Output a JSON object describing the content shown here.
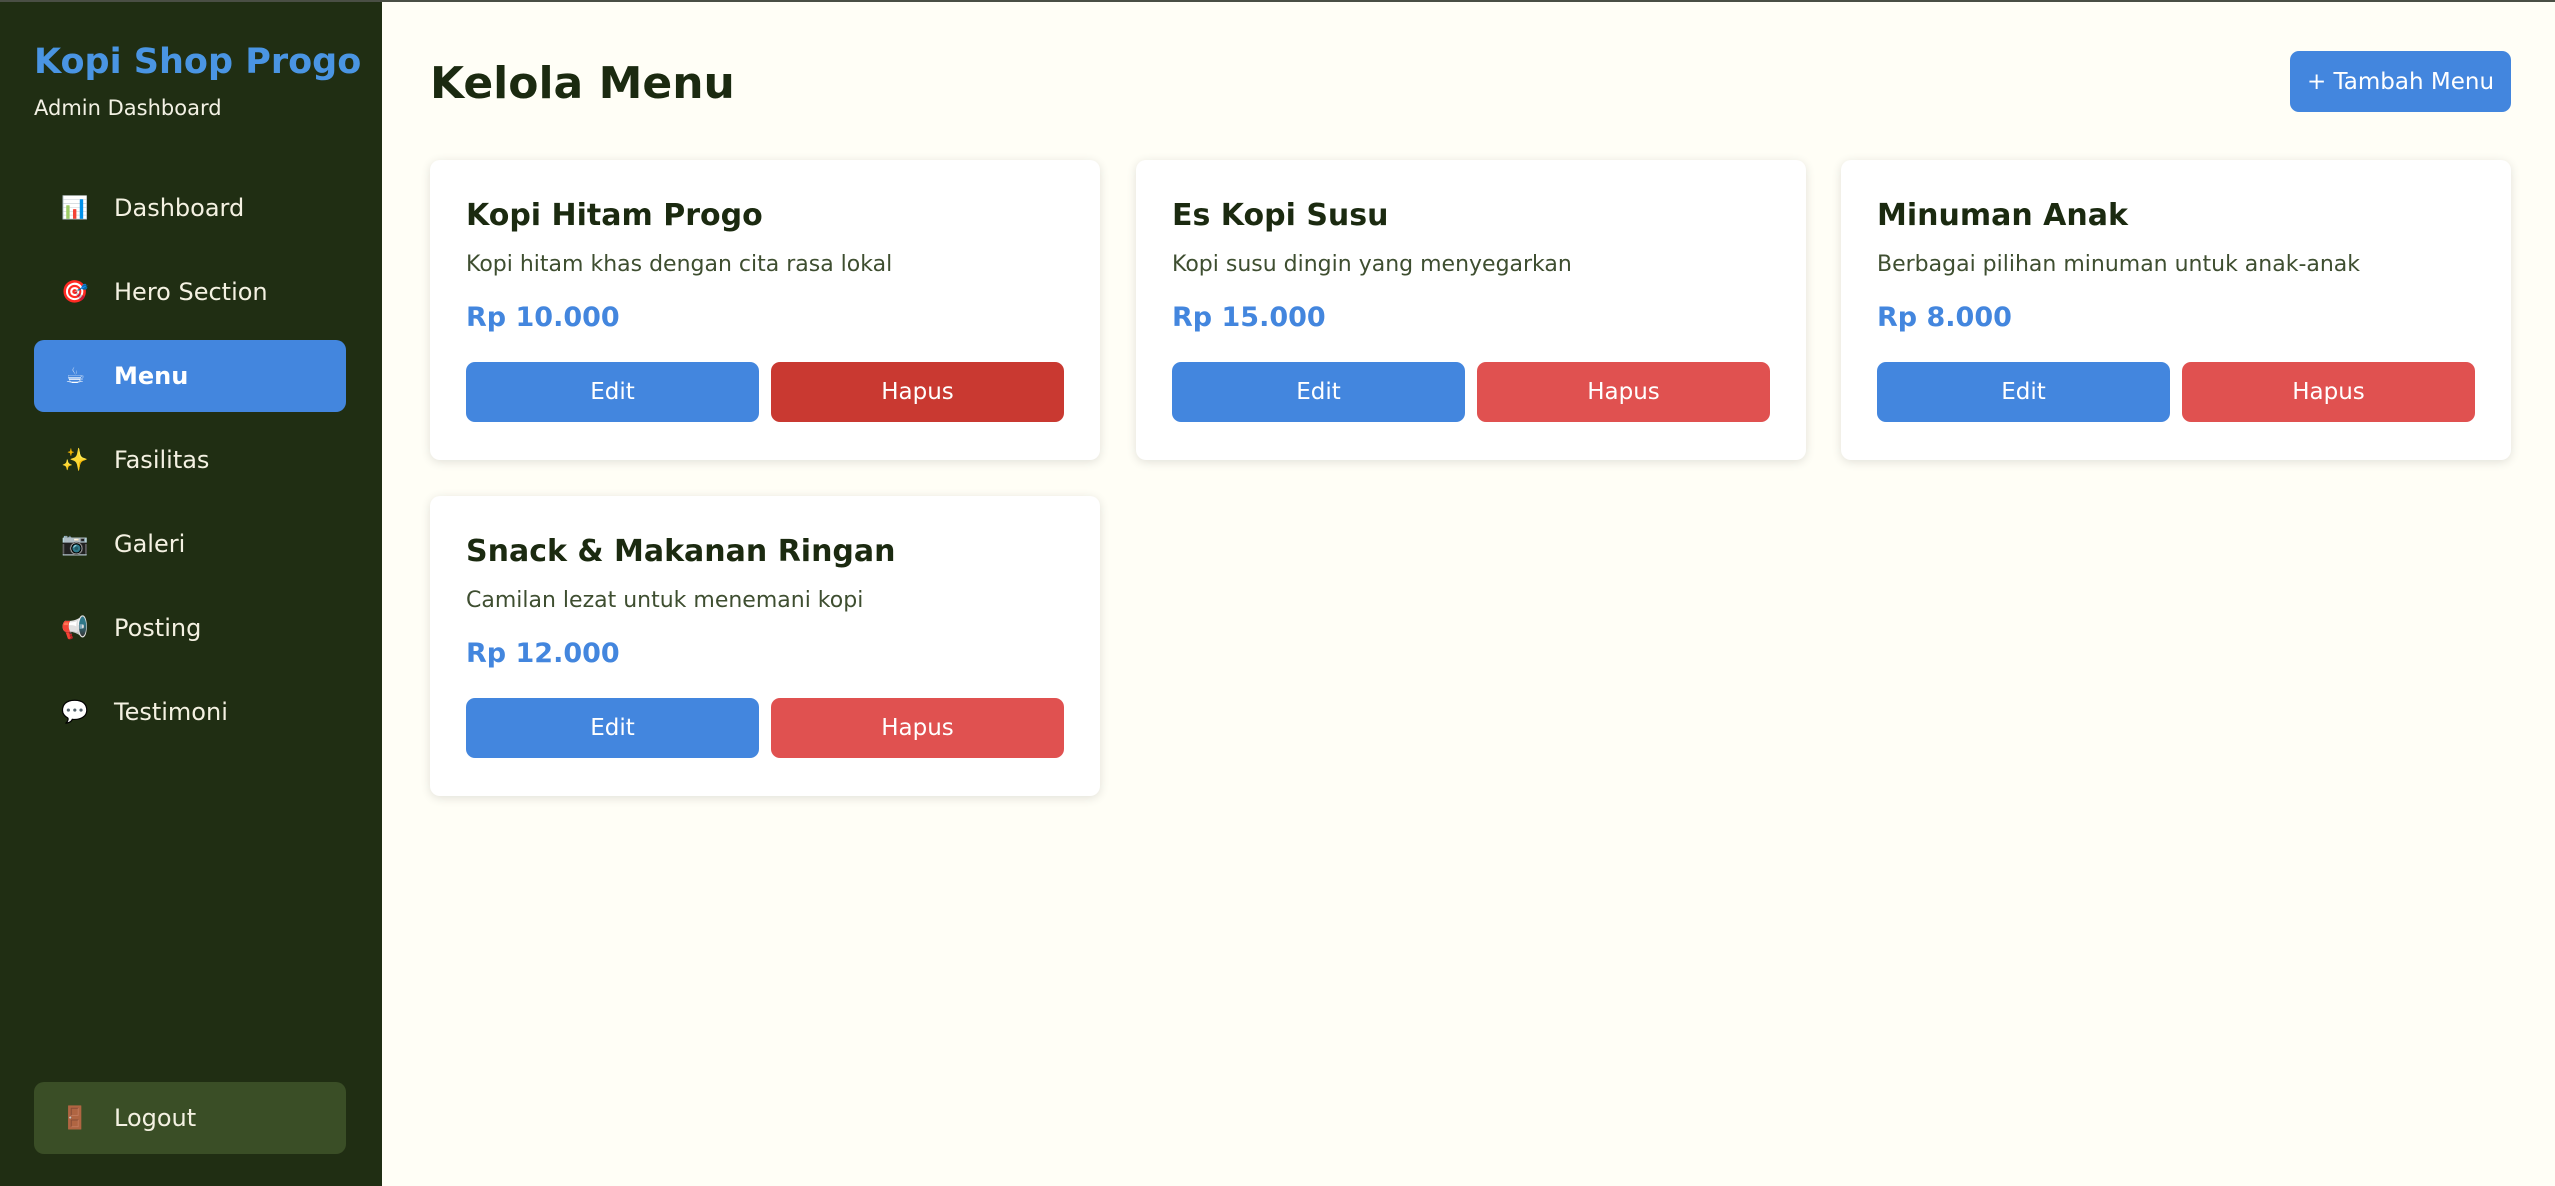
{
  "sidebar": {
    "brand": "Kopi Shop Progo",
    "subtitle": "Admin Dashboard",
    "items": [
      {
        "label": "Dashboard",
        "icon": "📊"
      },
      {
        "label": "Hero Section",
        "icon": "🎯"
      },
      {
        "label": "Menu",
        "icon": "☕"
      },
      {
        "label": "Fasilitas",
        "icon": "✨"
      },
      {
        "label": "Galeri",
        "icon": "📷"
      },
      {
        "label": "Posting",
        "icon": "📢"
      },
      {
        "label": "Testimoni",
        "icon": "💬"
      }
    ],
    "active_item": "Menu",
    "logout": {
      "label": "Logout",
      "icon": "🚪"
    }
  },
  "main": {
    "title": "Kelola Menu",
    "add_button": "+ Tambah Menu",
    "cards": [
      {
        "title": "Kopi Hitam Progo",
        "description": "Kopi hitam khas dengan cita rasa lokal",
        "price": "Rp 10.000",
        "edit": "Edit",
        "delete": "Hapus"
      },
      {
        "title": "Es Kopi Susu",
        "description": "Kopi susu dingin yang menyegarkan",
        "price": "Rp 15.000",
        "edit": "Edit",
        "delete": "Hapus"
      },
      {
        "title": "Minuman Anak",
        "description": "Berbagai pilihan minuman untuk anak-anak",
        "price": "Rp 8.000",
        "edit": "Edit",
        "delete": "Hapus"
      },
      {
        "title": "Snack & Makanan Ringan",
        "description": "Camilan lezat untuk menemani kopi",
        "price": "Rp 12.000",
        "edit": "Edit",
        "delete": "Hapus"
      }
    ]
  },
  "colors": {
    "sidebar_bg": "#202e13",
    "accent": "#4386de",
    "danger": "#e05150",
    "danger_hover": "#c93931",
    "page_bg": "#fffef6"
  }
}
